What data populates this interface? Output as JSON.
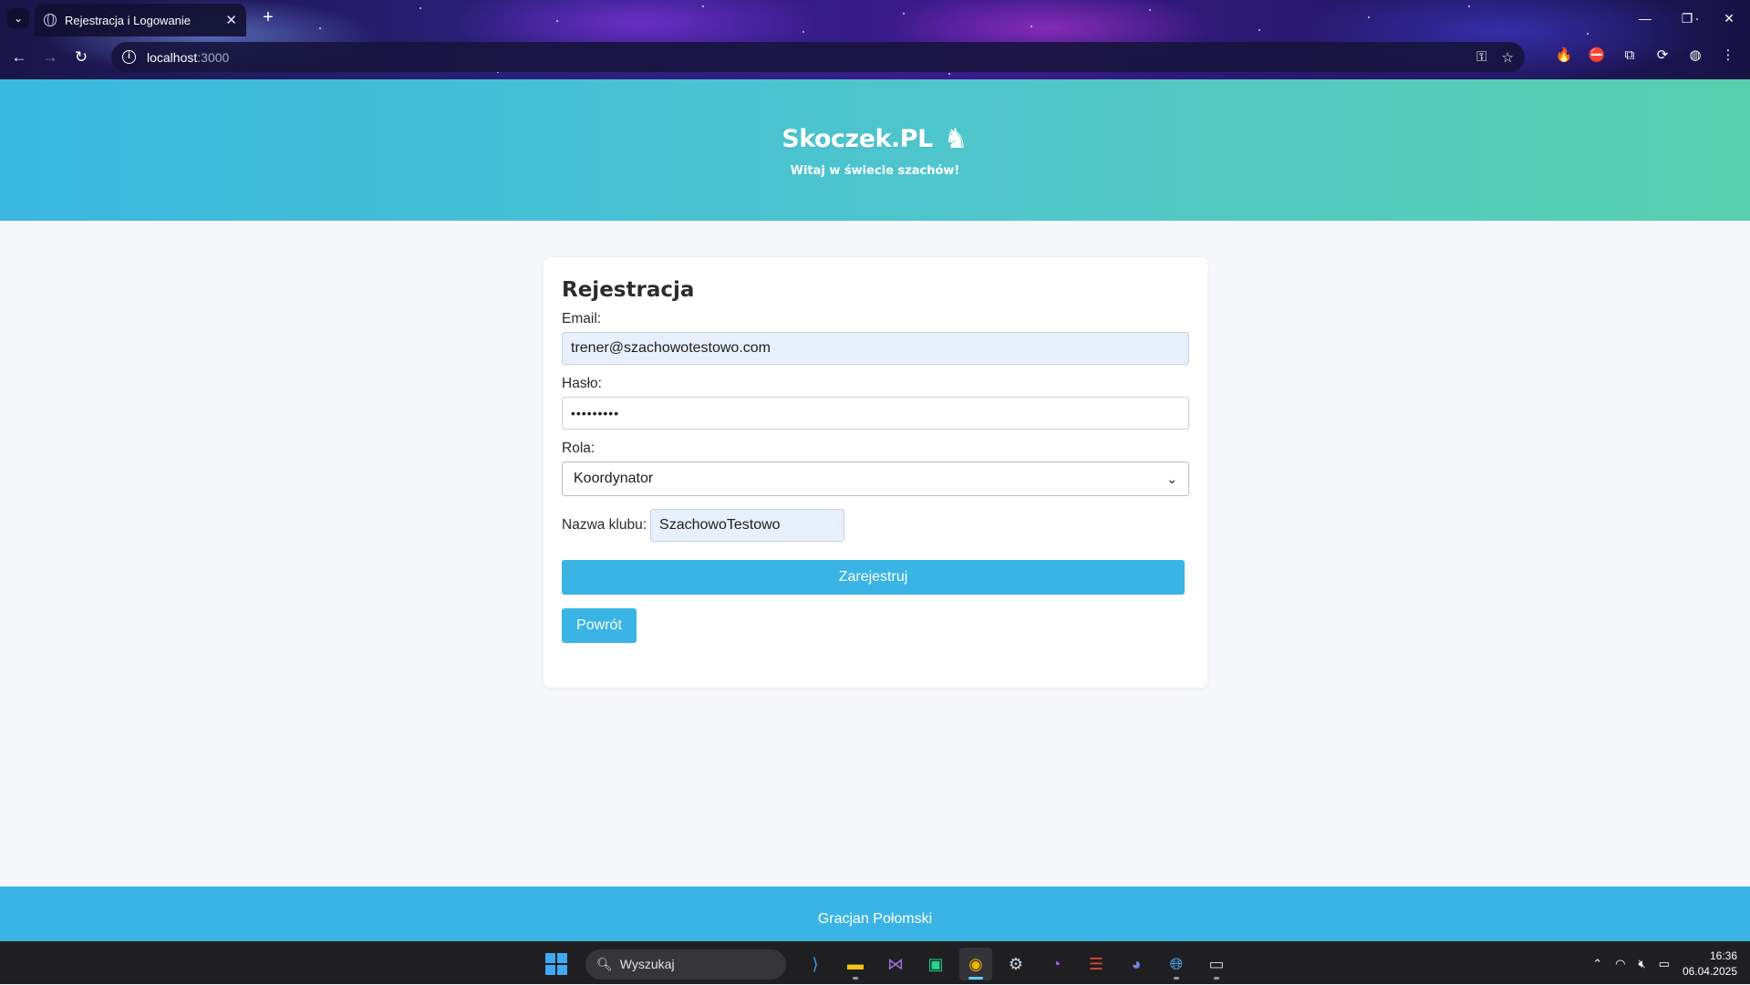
{
  "browser": {
    "tab_title": "Rejestracja i Logowanie",
    "url_host": "localhost",
    "url_port": ":3000"
  },
  "site": {
    "logo_text": "Skoczek.PL",
    "logo_icon": "chess-knight-icon",
    "tagline": "Witaj w świecie szachów!",
    "footer_text": "Gracjan Połomski"
  },
  "form": {
    "title": "Rejestracja",
    "email_label": "Email:",
    "email_value": "trener@szachowotestowo.com",
    "password_label": "Hasło:",
    "password_value": "•••••••••",
    "role_label": "Rola:",
    "role_selected": "Koordynator",
    "club_label": "Nazwa klubu:",
    "club_value": "SzachowoTestowo",
    "submit_label": "Zarejestruj",
    "back_label": "Powrót"
  },
  "colors": {
    "primary": "#3ab4e4",
    "header_gradient_start": "#3ab8df",
    "header_gradient_end": "#58d0ae",
    "autofill_bg": "#e8f0fe"
  },
  "taskbar": {
    "search_placeholder": "Wyszukaj",
    "time": "16:36",
    "date": "06.04.2025"
  }
}
